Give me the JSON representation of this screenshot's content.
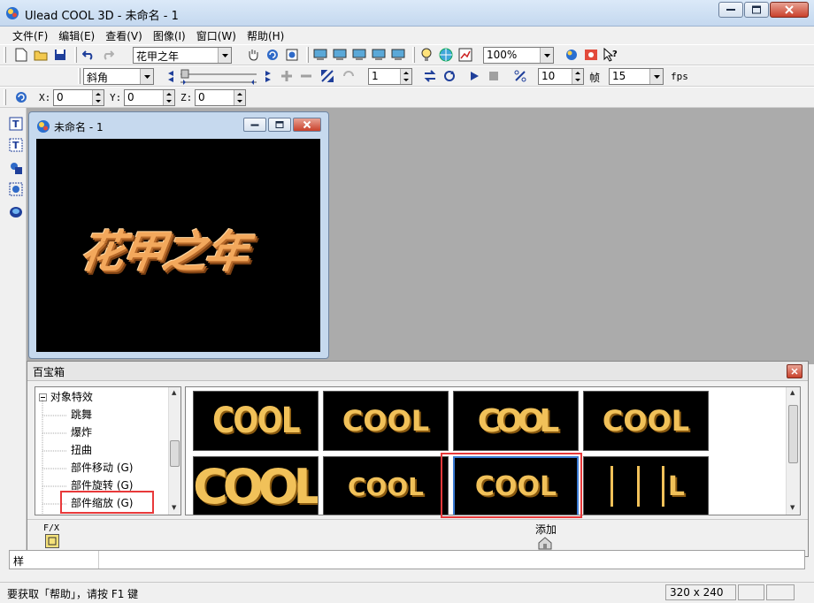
{
  "window": {
    "title": "Ulead COOL 3D - 未命名 - 1"
  },
  "menu": [
    "文件(F)",
    "编辑(E)",
    "查看(V)",
    "图像(I)",
    "窗口(W)",
    "帮助(H)"
  ],
  "toolbar1": {
    "text_combo": "花甲之年",
    "zoom_combo": "100%"
  },
  "toolbar2": {
    "bevel_combo": "斜角",
    "frame_value": "1",
    "fps_value": "10",
    "frame_label": "帧",
    "rate_combo": "15",
    "fps_label": "fps"
  },
  "toolbar3": {
    "x_label": "X:",
    "x_value": "0",
    "y_label": "Y:",
    "y_value": "0",
    "z_label": "Z:",
    "z_value": "0"
  },
  "child_window": {
    "title": "未命名 - 1",
    "canvas_text": "花甲之年"
  },
  "palette": {
    "title": "百宝箱",
    "tree_root": "对象特效",
    "tree_items": [
      "跳舞",
      "爆炸",
      "扭曲",
      "部件移动 (G)",
      "部件旋转 (G)",
      "部件缩放 (G)"
    ],
    "tiles": [
      "COOL",
      "COOL",
      "COOL",
      "COOL",
      "COOL",
      "COOL",
      "COOL",
      "L"
    ],
    "fx_label": "F/X",
    "add_label": "添加"
  },
  "sample_label": "样",
  "status": {
    "help_text": "要获取「帮助」，请按 F1 键",
    "size": "320 x 240"
  }
}
